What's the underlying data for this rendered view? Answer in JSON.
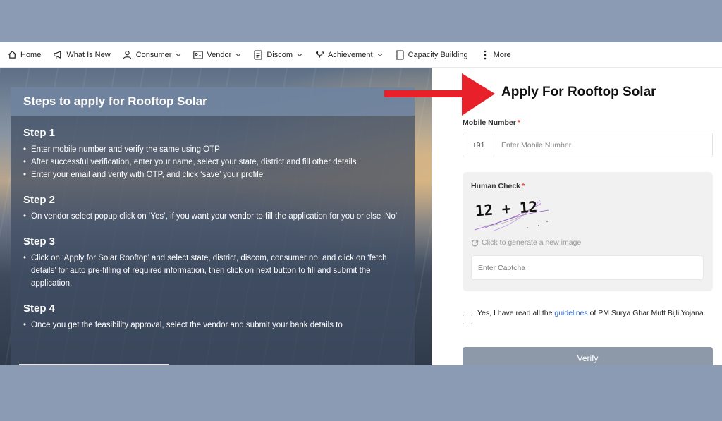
{
  "navbar": {
    "items": [
      {
        "label": "Home",
        "icon": "home-icon",
        "has_caret": false
      },
      {
        "label": "What Is New",
        "icon": "megaphone-icon",
        "has_caret": false
      },
      {
        "label": "Consumer",
        "icon": "user-icon",
        "has_caret": true
      },
      {
        "label": "Vendor",
        "icon": "id-card-icon",
        "has_caret": true
      },
      {
        "label": "Discom",
        "icon": "document-icon",
        "has_caret": true
      },
      {
        "label": "Achievement",
        "icon": "trophy-icon",
        "has_caret": true
      },
      {
        "label": "Capacity Building",
        "icon": "book-icon",
        "has_caret": false
      },
      {
        "label": "More",
        "icon": "more-vertical-icon",
        "has_caret": false
      }
    ]
  },
  "steps": {
    "title": "Steps to apply for Rooftop Solar",
    "items": [
      {
        "title": "Step 1",
        "points": [
          "Enter mobile number and verify the same using OTP",
          "After successful verification, enter your name, select your state, district and fill other details",
          "Enter your email and verify with OTP, and click ‘save’ your profile"
        ]
      },
      {
        "title": "Step 2",
        "points": [
          "On vendor select popup click on ‘Yes’, if you want your vendor to fill the application for you or else ‘No’"
        ]
      },
      {
        "title": "Step 3",
        "points": [
          "Click on ‘Apply for Solar Rooftop’ and select state, district, discom, consumer no. and click on ‘fetch details’ for auto pre-filling of required information, then click on next button to fill and submit the application."
        ]
      },
      {
        "title": "Step 4",
        "points": [
          "Once you get the feasibility approval, select the vendor and submit your bank details to"
        ]
      }
    ]
  },
  "form": {
    "title": "Apply For Rooftop Solar",
    "mobile_label": "Mobile Number",
    "required_mark": "*",
    "country_code": "+91",
    "mobile_placeholder": "Enter Mobile Number",
    "human_check_label": "Human Check",
    "captcha_text": "12 + 12",
    "regenerate_label": "Click to generate a new image",
    "captcha_placeholder": "Enter Captcha",
    "agree_prefix": "Yes, I have read all the ",
    "agree_link": "guidelines",
    "agree_suffix": " of PM Surya Ghar Muft Bijli Yojana.",
    "verify_label": "Verify"
  },
  "colors": {
    "background": "#8a9bb3",
    "arrow": "#e8202a",
    "link": "#2e6ac9",
    "verify_button": "#8d99a8",
    "required": "#e53935"
  }
}
